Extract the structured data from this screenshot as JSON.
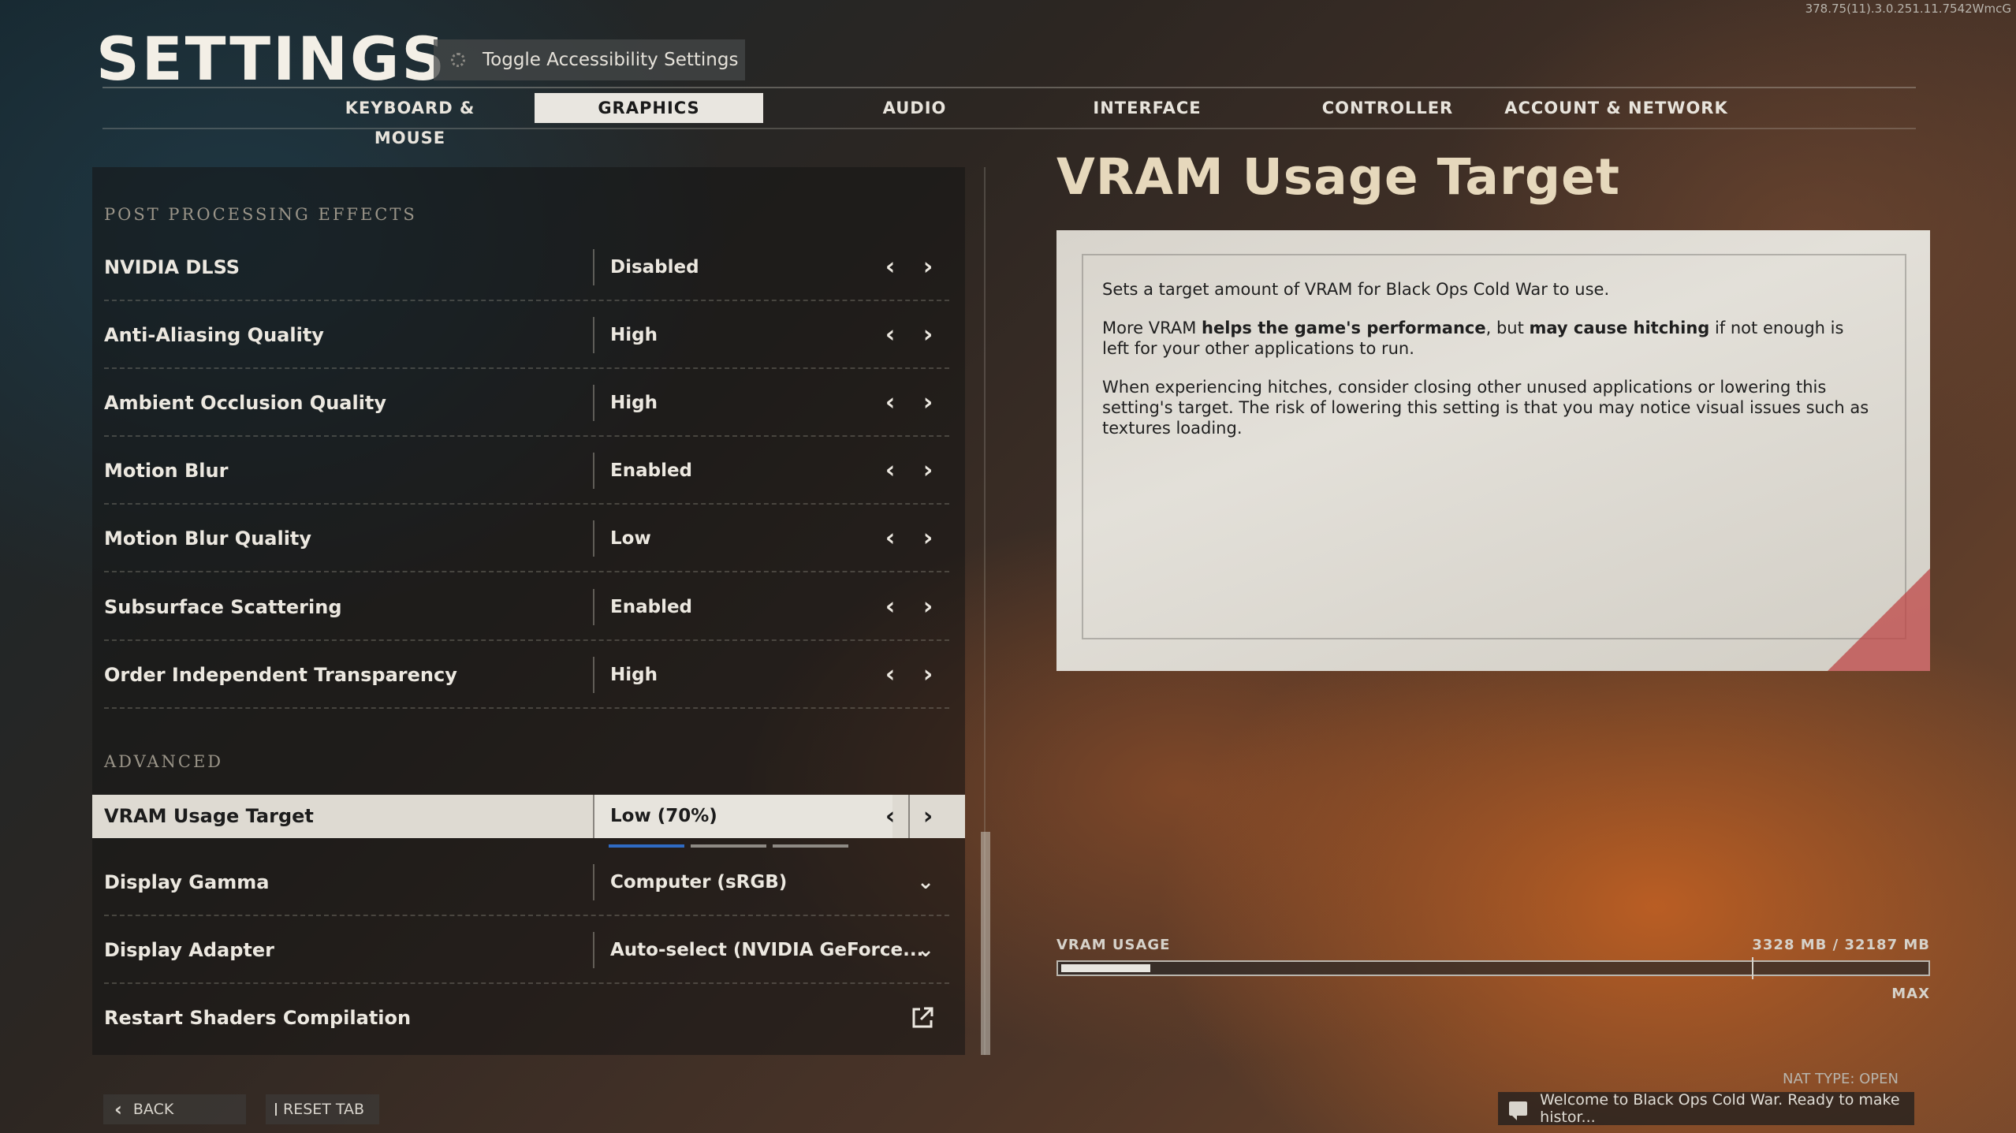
{
  "version_text": "378.75(11).3.0.251.11.7542WmcG",
  "header": {
    "title": "SETTINGS",
    "accessibility_button": "Toggle Accessibility Settings"
  },
  "tabs": [
    {
      "label": "KEYBOARD & MOUSE",
      "active": false
    },
    {
      "label": "GRAPHICS",
      "active": true
    },
    {
      "label": "AUDIO",
      "active": false
    },
    {
      "label": "INTERFACE",
      "active": false
    },
    {
      "label": "CONTROLLER",
      "active": false
    },
    {
      "label": "ACCOUNT & NETWORK",
      "active": false
    }
  ],
  "sections": {
    "post_processing": {
      "label": "POST PROCESSING EFFECTS",
      "items": [
        {
          "label": "NVIDIA DLSS",
          "value": "Disabled"
        },
        {
          "label": "Anti-Aliasing Quality",
          "value": "High"
        },
        {
          "label": "Ambient Occlusion Quality",
          "value": "High"
        },
        {
          "label": "Motion Blur",
          "value": "Enabled"
        },
        {
          "label": "Motion Blur Quality",
          "value": "Low"
        },
        {
          "label": "Subsurface Scattering",
          "value": "Enabled"
        },
        {
          "label": "Order Independent Transparency",
          "value": "High"
        }
      ]
    },
    "advanced": {
      "label": "ADVANCED",
      "items": [
        {
          "label": "VRAM Usage Target",
          "value": "Low (70%)",
          "control": "arrows",
          "selected": true,
          "level": 1,
          "levels": 3
        },
        {
          "label": "Display Gamma",
          "value": "Computer (sRGB)",
          "control": "dropdown"
        },
        {
          "label": "Display Adapter",
          "value": "Auto-select (NVIDIA GeForce...",
          "control": "dropdown"
        },
        {
          "label": "Restart Shaders Compilation",
          "value": "",
          "control": "external"
        }
      ]
    }
  },
  "detail": {
    "title": "VRAM Usage Target",
    "p1": "Sets a target amount of VRAM for Black Ops Cold War to use.",
    "p2_a": "More VRAM ",
    "p2_b": "helps the game's performance",
    "p2_c": ", but ",
    "p2_d": "may cause hitching",
    "p2_e": " if not enough is left for your other applications to run.",
    "p3": "When experiencing hitches, consider closing other unused applications or lowering this setting's target. The risk of lowering this setting is that you may notice visual issues such as textures loading."
  },
  "vram": {
    "label": "VRAM USAGE",
    "amount": "3328 MB / 32187 MB",
    "max_label": "MAX",
    "used_mb": 3328,
    "total_mb": 32187,
    "target_fraction": 0.797
  },
  "footer": {
    "back": "BACK",
    "reset": "RESET TAB",
    "nat": "NAT TYPE: OPEN",
    "chat": "Welcome to Black Ops Cold War. Ready to make histor..."
  },
  "colors": {
    "accent_blue": "#2f6bc4",
    "selected_bg": "#dedad2",
    "title_gold": "#e6d8bc"
  }
}
